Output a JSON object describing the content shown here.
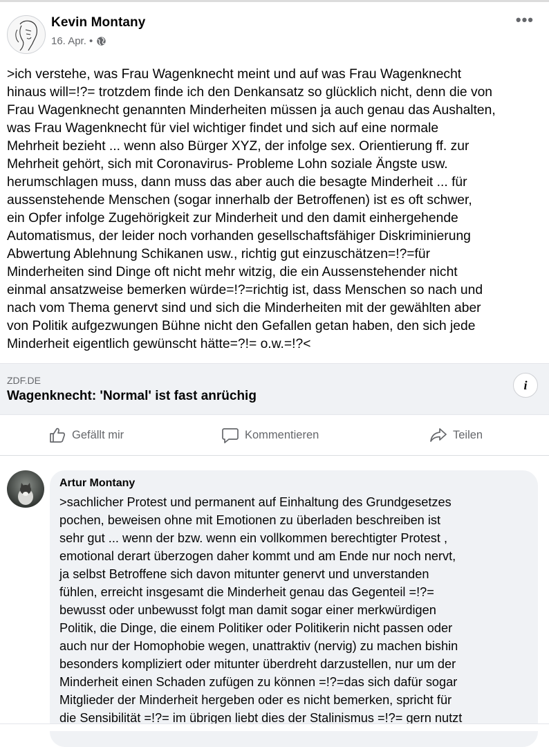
{
  "post": {
    "author": "Kevin Montany",
    "date": "16. Apr. •",
    "privacy_icon": "globe-icon",
    "more_icon": "more-options-icon",
    "more_label": "•••",
    "text": ">ich verstehe, was Frau Wagenknecht meint und auf was Frau Wagenknecht\nhinaus will=!?= trotzdem finde ich den Denkansatz so glücklich nicht, denn die von\nFrau Wagenknecht genannten Minderheiten müssen ja auch genau das Aushalten,\nwas Frau Wagenknecht für viel wichtiger findet und sich auf eine normale\nMehrheit bezieht ... wenn also Bürger XYZ, der infolge sex. Orientierung ff. zur\nMehrheit gehört,  sich mit Coronavirus- Probleme Lohn soziale Ängste usw.\nherumschlagen muss, dann muss das aber auch die besagte Minderheit ...  für\naussenstehende Menschen (sogar innerhalb der Betroffenen)  ist es oft schwer,\nein  Opfer infolge Zugehörigkeit zur Minderheit und den damit einhergehende\nAutomatismus, der leider noch vorhanden gesellschaftsfähiger Diskriminierung\nAbwertung Ablehnung Schikanen usw., richtig gut einzuschätzen=!?=für\nMinderheiten sind Dinge oft  nicht mehr witzig, die ein Aussenstehender nicht\neinmal ansatzweise bemerken würde=!?=richtig ist, dass Menschen so nach und\nnach vom Thema genervt sind und sich die Minderheiten mit der gewählten aber\nvon Politik aufgezwungen  Bühne nicht den Gefallen getan haben, den sich jede\nMinderheit eigentlich gewünscht hätte=?!=   o.w.=!?<"
  },
  "link_preview": {
    "domain": "ZDF.DE",
    "title": "Wagenknecht: 'Normal' ist fast anrüchig",
    "info_label": "i"
  },
  "actions": {
    "like": "Gefällt mir",
    "comment": "Kommentieren",
    "share": "Teilen"
  },
  "comment": {
    "author": "Artur Montany",
    "text": ">sachlicher Protest und permanent auf Einhaltung des Grundgesetzes\npochen, beweisen ohne mit Emotionen zu überladen beschreiben ist\nsehr gut ... wenn der bzw. wenn ein vollkommen berechtigter Protest ,\nemotional derart überzogen daher kommt und am Ende nur noch nervt,\nja selbst Betroffene sich davon mitunter genervt und unverstanden\nfühlen,  erreicht insgesamt die Minderheit genau das Gegenteil =!?=\nbewusst oder unbewusst folgt man damit  sogar einer merkwürdigen\nPolitik, die Dinge,  die einem Politiker oder Politikerin nicht passen oder\nauch nur der Homophobie wegen, unattraktiv (nervig) zu machen bishin\nbesonders kompliziert oder mitunter überdreht darzustellen, nur um der\nMinderheit einen Schaden zufügen zu können =!?=das sich dafür sogar\nMitglieder der Minderheit hergeben oder es nicht bemerken, spricht für\ndie Sensibilität =!?= im übrigen liebt dies der Stalinismus =!?= gern nutzt"
  }
}
